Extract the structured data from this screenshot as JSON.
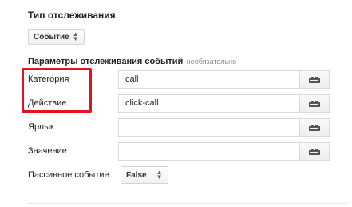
{
  "tracking_type": {
    "title": "Тип отслеживания",
    "select_value": "Событие"
  },
  "event_params": {
    "title": "Параметры отслеживания событий",
    "optional_note": "необязательно",
    "rows": [
      {
        "label": "Категория",
        "value": "call"
      },
      {
        "label": "Действие",
        "value": "click-call"
      },
      {
        "label": "Ярлык",
        "value": ""
      },
      {
        "label": "Значение",
        "value": ""
      }
    ],
    "noninteraction": {
      "label": "Пассивное событие",
      "select_value": "False"
    }
  },
  "icons": {
    "macro": "macro-picker-icon",
    "select_arrows": "up-down-arrows-icon"
  },
  "colors": {
    "highlight": "#e0141a"
  }
}
